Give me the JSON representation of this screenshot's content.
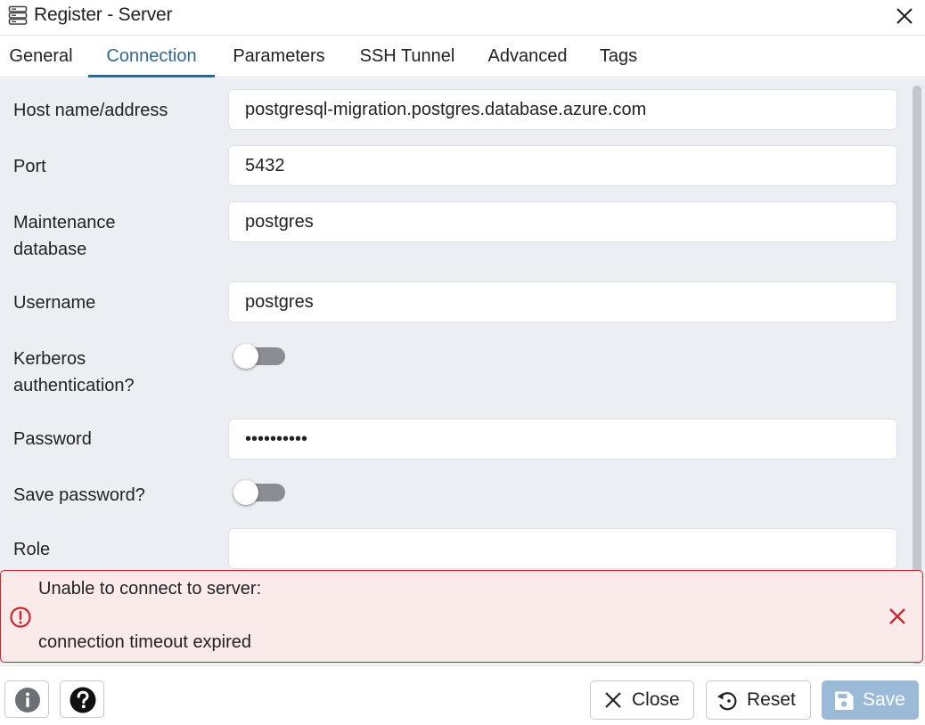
{
  "dialog": {
    "title": "Register - Server",
    "title_icon": "server-icon",
    "close_icon": "close-icon"
  },
  "tabs": [
    {
      "label": "General",
      "active": false
    },
    {
      "label": "Connection",
      "active": true
    },
    {
      "label": "Parameters",
      "active": false
    },
    {
      "label": "SSH Tunnel",
      "active": false
    },
    {
      "label": "Advanced",
      "active": false
    },
    {
      "label": "Tags",
      "active": false
    }
  ],
  "form": {
    "host": {
      "label": "Host name/address",
      "value": "postgresql-migration.postgres.database.azure.com"
    },
    "port": {
      "label": "Port",
      "value": "5432"
    },
    "maintenance_db": {
      "label_line1": "Maintenance",
      "label_line2": "database",
      "value": "postgres"
    },
    "username": {
      "label": "Username",
      "value": "postgres"
    },
    "kerberos": {
      "label_line1": "Kerberos",
      "label_line2": "authentication?",
      "enabled": false
    },
    "password": {
      "label": "Password",
      "value": "••••••••••"
    },
    "save_password": {
      "label": "Save password?",
      "enabled": false
    },
    "role": {
      "label": "Role",
      "value": ""
    }
  },
  "error": {
    "line1": "Unable to connect to server:",
    "line2": "connection timeout expired",
    "icon": "error-icon",
    "close_icon": "close-icon",
    "border_color": "#c9262e",
    "background_color": "#fbeaea"
  },
  "footer": {
    "info_icon": "info-icon",
    "help_icon": "help-icon",
    "close_label": "Close",
    "reset_label": "Reset",
    "save_label": "Save"
  },
  "colors": {
    "accent": "#326690",
    "save_button": "#9bbad7",
    "form_background": "#ebeef3"
  }
}
